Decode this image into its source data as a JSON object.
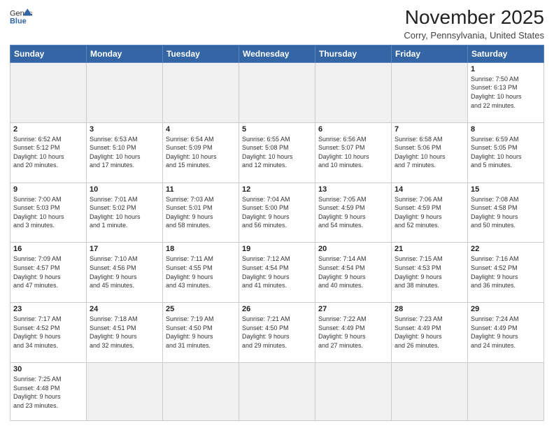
{
  "header": {
    "logo_general": "General",
    "logo_blue": "Blue",
    "month_title": "November 2025",
    "subtitle": "Corry, Pennsylvania, United States"
  },
  "days_of_week": [
    "Sunday",
    "Monday",
    "Tuesday",
    "Wednesday",
    "Thursday",
    "Friday",
    "Saturday"
  ],
  "weeks": [
    [
      {
        "day": "",
        "empty": true
      },
      {
        "day": "",
        "empty": true
      },
      {
        "day": "",
        "empty": true
      },
      {
        "day": "",
        "empty": true
      },
      {
        "day": "",
        "empty": true
      },
      {
        "day": "",
        "empty": true
      },
      {
        "day": "1",
        "info": "Sunrise: 7:50 AM\nSunset: 6:13 PM\nDaylight: 10 hours\nand 22 minutes."
      }
    ],
    [
      {
        "day": "2",
        "info": "Sunrise: 6:52 AM\nSunset: 5:12 PM\nDaylight: 10 hours\nand 20 minutes."
      },
      {
        "day": "3",
        "info": "Sunrise: 6:53 AM\nSunset: 5:10 PM\nDaylight: 10 hours\nand 17 minutes."
      },
      {
        "day": "4",
        "info": "Sunrise: 6:54 AM\nSunset: 5:09 PM\nDaylight: 10 hours\nand 15 minutes."
      },
      {
        "day": "5",
        "info": "Sunrise: 6:55 AM\nSunset: 5:08 PM\nDaylight: 10 hours\nand 12 minutes."
      },
      {
        "day": "6",
        "info": "Sunrise: 6:56 AM\nSunset: 5:07 PM\nDaylight: 10 hours\nand 10 minutes."
      },
      {
        "day": "7",
        "info": "Sunrise: 6:58 AM\nSunset: 5:06 PM\nDaylight: 10 hours\nand 7 minutes."
      },
      {
        "day": "8",
        "info": "Sunrise: 6:59 AM\nSunset: 5:05 PM\nDaylight: 10 hours\nand 5 minutes."
      }
    ],
    [
      {
        "day": "9",
        "info": "Sunrise: 7:00 AM\nSunset: 5:03 PM\nDaylight: 10 hours\nand 3 minutes."
      },
      {
        "day": "10",
        "info": "Sunrise: 7:01 AM\nSunset: 5:02 PM\nDaylight: 10 hours\nand 1 minute."
      },
      {
        "day": "11",
        "info": "Sunrise: 7:03 AM\nSunset: 5:01 PM\nDaylight: 9 hours\nand 58 minutes."
      },
      {
        "day": "12",
        "info": "Sunrise: 7:04 AM\nSunset: 5:00 PM\nDaylight: 9 hours\nand 56 minutes."
      },
      {
        "day": "13",
        "info": "Sunrise: 7:05 AM\nSunset: 4:59 PM\nDaylight: 9 hours\nand 54 minutes."
      },
      {
        "day": "14",
        "info": "Sunrise: 7:06 AM\nSunset: 4:59 PM\nDaylight: 9 hours\nand 52 minutes."
      },
      {
        "day": "15",
        "info": "Sunrise: 7:08 AM\nSunset: 4:58 PM\nDaylight: 9 hours\nand 50 minutes."
      }
    ],
    [
      {
        "day": "16",
        "info": "Sunrise: 7:09 AM\nSunset: 4:57 PM\nDaylight: 9 hours\nand 47 minutes."
      },
      {
        "day": "17",
        "info": "Sunrise: 7:10 AM\nSunset: 4:56 PM\nDaylight: 9 hours\nand 45 minutes."
      },
      {
        "day": "18",
        "info": "Sunrise: 7:11 AM\nSunset: 4:55 PM\nDaylight: 9 hours\nand 43 minutes."
      },
      {
        "day": "19",
        "info": "Sunrise: 7:12 AM\nSunset: 4:54 PM\nDaylight: 9 hours\nand 41 minutes."
      },
      {
        "day": "20",
        "info": "Sunrise: 7:14 AM\nSunset: 4:54 PM\nDaylight: 9 hours\nand 40 minutes."
      },
      {
        "day": "21",
        "info": "Sunrise: 7:15 AM\nSunset: 4:53 PM\nDaylight: 9 hours\nand 38 minutes."
      },
      {
        "day": "22",
        "info": "Sunrise: 7:16 AM\nSunset: 4:52 PM\nDaylight: 9 hours\nand 36 minutes."
      }
    ],
    [
      {
        "day": "23",
        "info": "Sunrise: 7:17 AM\nSunset: 4:52 PM\nDaylight: 9 hours\nand 34 minutes."
      },
      {
        "day": "24",
        "info": "Sunrise: 7:18 AM\nSunset: 4:51 PM\nDaylight: 9 hours\nand 32 minutes."
      },
      {
        "day": "25",
        "info": "Sunrise: 7:19 AM\nSunset: 4:50 PM\nDaylight: 9 hours\nand 31 minutes."
      },
      {
        "day": "26",
        "info": "Sunrise: 7:21 AM\nSunset: 4:50 PM\nDaylight: 9 hours\nand 29 minutes."
      },
      {
        "day": "27",
        "info": "Sunrise: 7:22 AM\nSunset: 4:49 PM\nDaylight: 9 hours\nand 27 minutes."
      },
      {
        "day": "28",
        "info": "Sunrise: 7:23 AM\nSunset: 4:49 PM\nDaylight: 9 hours\nand 26 minutes."
      },
      {
        "day": "29",
        "info": "Sunrise: 7:24 AM\nSunset: 4:49 PM\nDaylight: 9 hours\nand 24 minutes."
      }
    ],
    [
      {
        "day": "30",
        "info": "Sunrise: 7:25 AM\nSunset: 4:48 PM\nDaylight: 9 hours\nand 23 minutes.",
        "last": true
      },
      {
        "day": "",
        "empty": true,
        "last": true
      },
      {
        "day": "",
        "empty": true,
        "last": true
      },
      {
        "day": "",
        "empty": true,
        "last": true
      },
      {
        "day": "",
        "empty": true,
        "last": true
      },
      {
        "day": "",
        "empty": true,
        "last": true
      },
      {
        "day": "",
        "empty": true,
        "last": true
      }
    ]
  ]
}
